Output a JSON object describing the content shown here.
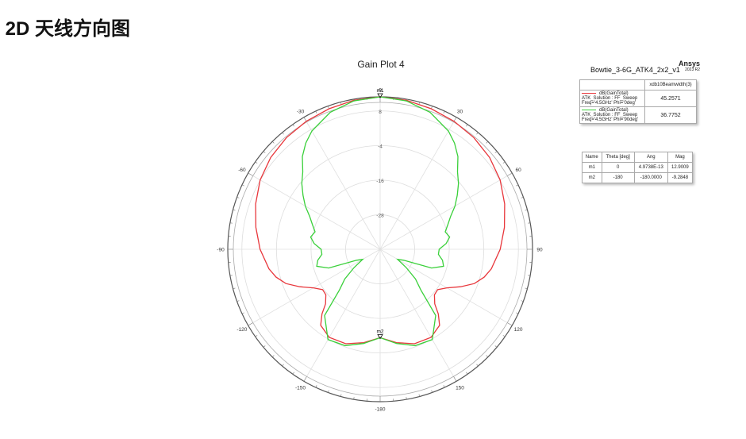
{
  "page": {
    "heading_prefix": ".",
    "heading": "2D 天线方向图"
  },
  "chart_data": {
    "type": "polar",
    "title": "Gain Plot 4",
    "design_name": "Bowtie_3-6G_ATK4_2x2_v1",
    "brand": "Ansys",
    "brand_version": "2023 R2",
    "radial_ticks": [
      8,
      -4,
      -16,
      -28
    ],
    "radial_range": [
      -40,
      12.9
    ],
    "angle_ticks": [
      0,
      30,
      60,
      90,
      120,
      150,
      180,
      -150,
      -120,
      -90,
      -60,
      -30
    ],
    "angle_labels": [
      "0",
      "30",
      "60",
      "90",
      "120",
      "150",
      "-180",
      "-150",
      "-120",
      "-90",
      "-60",
      "-30"
    ],
    "series": [
      {
        "name": "dB(GainTotal)",
        "setup": "ATK_Solution : FF_Sweep",
        "variation": "Freq='4.5GHz' Phi='0deg'",
        "color": "#e8373c",
        "beamwidth": "45.2571",
        "points": [
          [
            0,
            12.9
          ],
          [
            10,
            12.5
          ],
          [
            20,
            11.9
          ],
          [
            30,
            11.3
          ],
          [
            40,
            10.6
          ],
          [
            50,
            9.6
          ],
          [
            60,
            8.1
          ],
          [
            70,
            6.0
          ],
          [
            80,
            3.8
          ],
          [
            90,
            1.7
          ],
          [
            100,
            -0.8
          ],
          [
            105,
            -2.6
          ],
          [
            110,
            -5.2
          ],
          [
            115,
            -9.2
          ],
          [
            120,
            -13.2
          ],
          [
            125,
            -15.6
          ],
          [
            130,
            -15.4
          ],
          [
            135,
            -13.2
          ],
          [
            138,
            -9.8
          ],
          [
            142,
            -6.5
          ],
          [
            150,
            -4.7
          ],
          [
            160,
            -5.1
          ],
          [
            170,
            -7.1
          ],
          [
            180,
            -9.3
          ]
        ]
      },
      {
        "name": "dB(GainTotal)",
        "setup": "ATK_Solution : FF_Sweep",
        "variation": "Freq='4.5GHz' Phi='90deg'",
        "color": "#3ad03a",
        "beamwidth": "36.7752",
        "points": [
          [
            0,
            12.9
          ],
          [
            10,
            12.3
          ],
          [
            20,
            10.6
          ],
          [
            30,
            7.4
          ],
          [
            35,
            5.0
          ],
          [
            40,
            2.0
          ],
          [
            45,
            -2.0
          ],
          [
            50,
            -4.5
          ],
          [
            55,
            -7.3
          ],
          [
            60,
            -10.0
          ],
          [
            65,
            -13.0
          ],
          [
            70,
            -15.0
          ],
          [
            75,
            -16.6
          ],
          [
            80,
            -15.5
          ],
          [
            85,
            -17.0
          ],
          [
            90,
            -19.5
          ],
          [
            95,
            -19.7
          ],
          [
            100,
            -18.0
          ],
          [
            105,
            -17.2
          ],
          [
            110,
            -21.0
          ],
          [
            115,
            -31.0
          ],
          [
            120,
            -33.0
          ],
          [
            125,
            -29.0
          ],
          [
            130,
            -24.0
          ],
          [
            135,
            -20.0
          ],
          [
            140,
            -10.0
          ],
          [
            150,
            -3.8
          ],
          [
            160,
            -4.4
          ],
          [
            170,
            -6.8
          ],
          [
            180,
            -9.3
          ]
        ]
      }
    ],
    "markers": [
      {
        "name": "m1",
        "theta": "0",
        "ang": "4.9738E-13",
        "mag": "12.9009",
        "angle_deg": 0,
        "gain_db": 12.9
      },
      {
        "name": "m2",
        "theta": "-180",
        "ang": "-180.0000",
        "mag": "-9.2848",
        "angle_deg": 180,
        "gain_db": -9.28
      }
    ]
  },
  "legend": {
    "header": "xdb10Beamwidth(3)"
  },
  "marker_table": {
    "headers": [
      "Name",
      "Theta [deg]",
      "Ang",
      "Mag"
    ]
  }
}
